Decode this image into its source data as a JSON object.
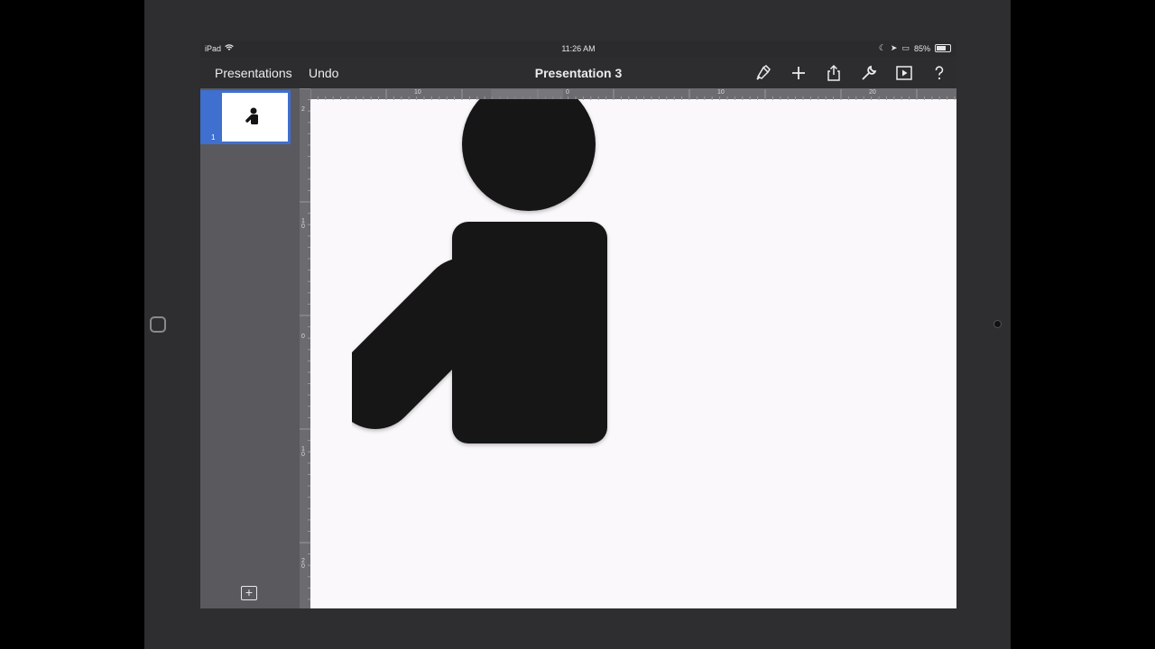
{
  "status_bar": {
    "carrier": "iPad",
    "time": "11:26 AM",
    "battery": "85%",
    "battery_level": 0.85
  },
  "toolbar": {
    "back_label": "Presentations",
    "undo_label": "Undo",
    "title": "Presentation 3",
    "icons": [
      "paintbrush-icon",
      "plus-icon",
      "share-icon",
      "wrench-icon",
      "play-icon",
      "help-icon"
    ]
  },
  "sidebar": {
    "slides": [
      {
        "number": "1"
      }
    ],
    "add_slide_icon": "plus-box-icon"
  },
  "rulers": {
    "top": [
      "10",
      "0",
      "10",
      "20"
    ],
    "left": [
      "2",
      "1\n0",
      "0",
      "1\n0",
      "2\n0"
    ]
  },
  "colors": {
    "selection": "#3f6fcf",
    "figure": "#141416",
    "canvas": "#fbf8fc"
  }
}
